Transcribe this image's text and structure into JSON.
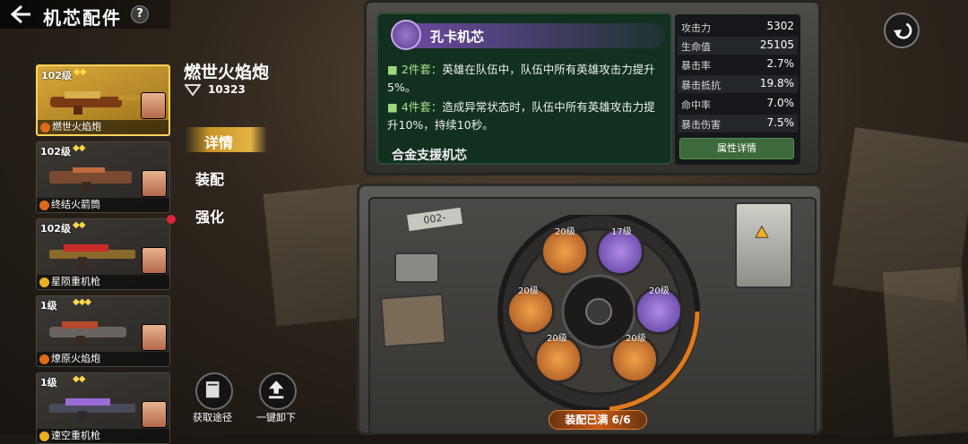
{
  "header": {
    "title": "机芯配件",
    "help": "?"
  },
  "weapons": [
    {
      "level": "102级",
      "stars": "◆◆",
      "name": "燃世火焰炮",
      "elem": "#e06a1a",
      "selected": true
    },
    {
      "level": "102级",
      "stars": "◆◆",
      "name": "终结火箭筒",
      "elem": "#e06a1a",
      "selected": false
    },
    {
      "level": "102级",
      "stars": "◆◆",
      "name": "星陨重机枪",
      "elem": "#e8b020",
      "selected": false
    },
    {
      "level": "1级",
      "stars": "◆◆◆",
      "name": "燎原火焰炮",
      "elem": "#e06a1a",
      "selected": false
    },
    {
      "level": "1级",
      "stars": "◆◆",
      "name": "速空重机枪",
      "elem": "#e8b020",
      "selected": false
    }
  ],
  "weapon": {
    "name": "燃世火焰炮",
    "power": "10323"
  },
  "tabs": {
    "detail": "详情",
    "equip": "装配",
    "enhance": "强化"
  },
  "bottom": {
    "obtain": "获取途径",
    "unload": "一键卸下"
  },
  "chip": {
    "name": "孔卡机芯",
    "set2_label": "2件套：",
    "set2_text": "英雄在队伍中，队伍中所有英雄攻击力提升5%。",
    "set4_label": "4件套：",
    "set4_text": "造成异常状态时，队伍中所有英雄攻击力提升10%，持续10秒。",
    "sub": "合金支援机芯"
  },
  "stats": [
    {
      "k": "攻击力",
      "v": "5302"
    },
    {
      "k": "生命值",
      "v": "25105"
    },
    {
      "k": "暴击率",
      "v": "2.7%"
    },
    {
      "k": "暴击抵抗",
      "v": "19.8%"
    },
    {
      "k": "命中率",
      "v": "7.0%"
    },
    {
      "k": "暴击伤害",
      "v": "7.5%"
    }
  ],
  "attr_button": "属性详情",
  "slots": [
    {
      "lvl": "20级",
      "color": "orange"
    },
    {
      "lvl": "17级",
      "color": "purple"
    },
    {
      "lvl": "20级",
      "color": "orange"
    },
    {
      "lvl": "20级",
      "color": "purple"
    },
    {
      "lvl": "20级",
      "color": "orange"
    },
    {
      "lvl": "20级",
      "color": "orange"
    }
  ],
  "equip_status": "装配已满 6/6",
  "case_label": "002-"
}
